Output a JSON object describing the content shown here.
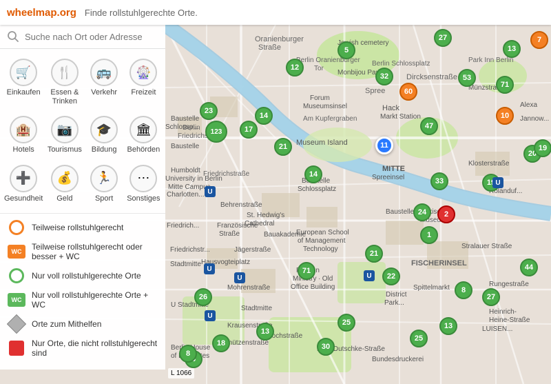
{
  "header": {
    "logo_prefix": "wheelmap",
    "logo_suffix": ".org",
    "tagline": "Finde rollstuhlgerechte Orte."
  },
  "search": {
    "placeholder": "Suche nach Ort oder Adresse"
  },
  "categories": [
    {
      "id": "einkaufen",
      "label": "Einkaufen",
      "icon": "🛒"
    },
    {
      "id": "essen-trinken",
      "label": "Essen & Trinken",
      "icon": "🍴"
    },
    {
      "id": "verkehr",
      "label": "Verkehr",
      "icon": "🚌"
    },
    {
      "id": "freizeit",
      "label": "Freizeit",
      "icon": "🎡"
    },
    {
      "id": "hotels",
      "label": "Hotels",
      "icon": "🏨"
    },
    {
      "id": "tourismus",
      "label": "Tourismus",
      "icon": "📷"
    },
    {
      "id": "bildung",
      "label": "Bildung",
      "icon": "🎓"
    },
    {
      "id": "behoerden",
      "label": "Behörden",
      "icon": "🏛"
    },
    {
      "id": "gesundheit",
      "label": "Gesundheit",
      "icon": "➕"
    },
    {
      "id": "geld",
      "label": "Geld",
      "icon": "💰"
    },
    {
      "id": "sport",
      "label": "Sport",
      "icon": "🏃"
    },
    {
      "id": "sonstiges",
      "label": "Sonstiges",
      "icon": "⋯"
    }
  ],
  "legend": [
    {
      "id": "partial",
      "type": "orange-ring",
      "text": "Teilweise rollstuhlgerecht"
    },
    {
      "id": "partial-wc",
      "type": "orange-wc",
      "text": "Teilweise rollstuhlgerecht oder besser + WC"
    },
    {
      "id": "full",
      "type": "green-ring",
      "text": "Nur voll rollstuhlgerechte Orte"
    },
    {
      "id": "full-wc",
      "type": "green-wc",
      "text": "Nur voll rollstuhlgerechte Orte + WC"
    },
    {
      "id": "help",
      "type": "diamond",
      "text": "Orte zum Mithelfen"
    },
    {
      "id": "not",
      "type": "red-square",
      "text": "Nur Orte, die nicht rollstuhlgerecht sind"
    }
  ],
  "legend_wc_label": "WC",
  "map": {
    "attribution": "L 1066",
    "clusters": [
      {
        "id": "c1",
        "value": "23",
        "color": "green",
        "top": "148",
        "left": "290"
      },
      {
        "id": "c2",
        "value": "12",
        "color": "green",
        "top": "85",
        "left": "415"
      },
      {
        "id": "c3",
        "value": "5",
        "color": "green",
        "top": "60",
        "left": "490"
      },
      {
        "id": "c4",
        "value": "27",
        "color": "green",
        "top": "42",
        "left": "630"
      },
      {
        "id": "c5",
        "value": "32",
        "color": "green",
        "top": "98",
        "left": "545"
      },
      {
        "id": "c6",
        "value": "60",
        "color": "orange",
        "top": "120",
        "left": "580"
      },
      {
        "id": "c7",
        "value": "53",
        "color": "green",
        "top": "100",
        "left": "665"
      },
      {
        "id": "c8",
        "value": "71",
        "color": "green",
        "top": "110",
        "left": "720"
      },
      {
        "id": "c9",
        "value": "11",
        "color": "selected",
        "top": "198",
        "left": "545"
      },
      {
        "id": "c10",
        "value": "47",
        "color": "green",
        "top": "170",
        "left": "610"
      },
      {
        "id": "c11",
        "value": "10",
        "color": "orange",
        "top": "155",
        "left": "720"
      },
      {
        "id": "c12",
        "value": "20",
        "color": "green",
        "top": "210",
        "left": "760"
      },
      {
        "id": "c13",
        "value": "19",
        "color": "green",
        "top": "252",
        "left": "700"
      },
      {
        "id": "c14",
        "value": "33",
        "color": "green",
        "top": "250",
        "left": "625"
      },
      {
        "id": "c15",
        "value": "24",
        "color": "green",
        "top": "295",
        "left": "600"
      },
      {
        "id": "c16",
        "value": "2",
        "color": "red",
        "top": "298",
        "left": "635"
      },
      {
        "id": "c17",
        "value": "1",
        "color": "green",
        "top": "328",
        "left": "610"
      },
      {
        "id": "c18",
        "value": "21",
        "color": "green",
        "top": "355",
        "left": "530"
      },
      {
        "id": "c19",
        "value": "22",
        "color": "green",
        "top": "388",
        "left": "555"
      },
      {
        "id": "c20",
        "value": "8",
        "color": "green",
        "top": "408",
        "left": "660"
      },
      {
        "id": "c21",
        "value": "27",
        "color": "green",
        "top": "418",
        "left": "700"
      },
      {
        "id": "c22",
        "value": "44",
        "color": "green",
        "top": "375",
        "left": "755"
      },
      {
        "id": "c23",
        "value": "13",
        "color": "green",
        "top": "58",
        "left": "730"
      },
      {
        "id": "c24",
        "value": "7",
        "color": "orange",
        "top": "45",
        "left": "770"
      },
      {
        "id": "c25",
        "value": "19",
        "color": "green",
        "top": "202",
        "left": "775"
      },
      {
        "id": "c26",
        "value": "17",
        "color": "green",
        "top": "175",
        "left": "348"
      },
      {
        "id": "c27",
        "value": "21",
        "color": "green",
        "top": "200",
        "left": "398"
      },
      {
        "id": "c28",
        "value": "14",
        "color": "green",
        "top": "240",
        "left": "442"
      },
      {
        "id": "c29",
        "value": "14",
        "color": "green",
        "top": "155",
        "left": "370"
      },
      {
        "id": "c30",
        "value": "25",
        "color": "green",
        "top": "455",
        "left": "490"
      },
      {
        "id": "c31",
        "value": "25",
        "color": "green",
        "top": "478",
        "left": "595"
      },
      {
        "id": "c32",
        "value": "30",
        "color": "green",
        "top": "490",
        "left": "460"
      },
      {
        "id": "c33",
        "value": "18",
        "color": "green",
        "top": "485",
        "left": "308"
      },
      {
        "id": "c34",
        "value": "6",
        "color": "green",
        "top": "508",
        "left": "268"
      },
      {
        "id": "c35",
        "value": "8",
        "color": "green",
        "top": "500",
        "left": "260"
      },
      {
        "id": "c36",
        "value": "13",
        "color": "green",
        "top": "468",
        "left": "372"
      },
      {
        "id": "c37",
        "value": "13",
        "color": "green",
        "top": "460",
        "left": "638"
      },
      {
        "id": "c38",
        "value": "71",
        "color": "green",
        "top": "380",
        "left": "432"
      },
      {
        "id": "c39",
        "value": "26",
        "color": "green",
        "top": "418",
        "left": "282"
      },
      {
        "id": "c40",
        "value": "123",
        "color": "green",
        "top": "175",
        "left": "298"
      }
    ]
  }
}
